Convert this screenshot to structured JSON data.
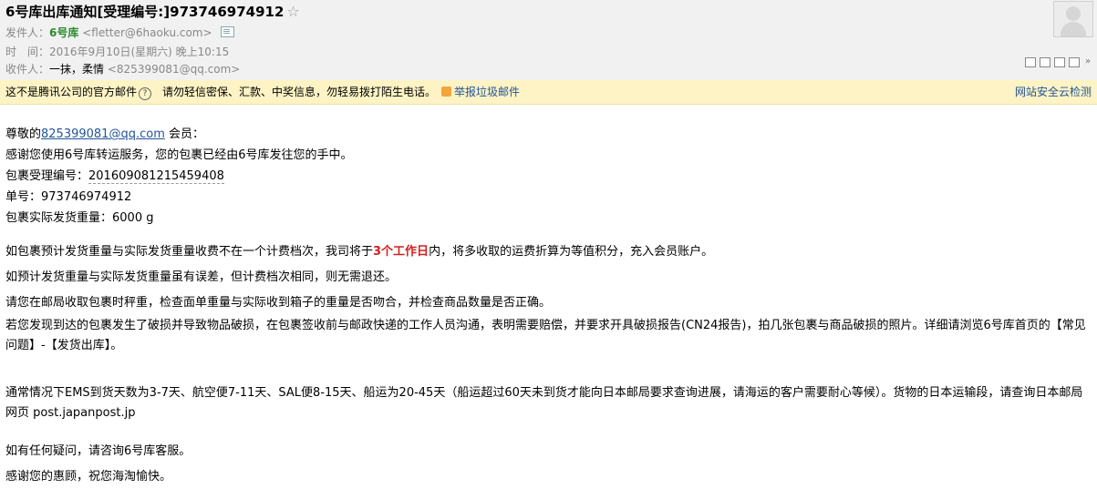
{
  "header": {
    "subject": "6号库出库通知[受理编号:]973746974912",
    "star_glyph": "☆",
    "from_label": "发件人：",
    "from_name": "6号库",
    "from_addr": "<fletter@6haoku.com>",
    "time_label": "时　间：",
    "time_value": "2016年9月10日(星期六) 晚上10:15",
    "to_label": "收件人：",
    "to_names": "一抹，柔情",
    "to_addr": "<825399081@qq.com>"
  },
  "warning": {
    "left_text": "这不是腾讯公司的官方邮件",
    "help_glyph": "?",
    "tip_text": "请勿轻信密保、汇款、中奖信息，勿轻易拨打陌生电话。",
    "report_label": "举报垃圾邮件",
    "security_label": "网站安全云检测"
  },
  "body": {
    "greeting_prefix": "尊敬的",
    "greeting_email": "825399081@qq.com",
    "greeting_suffix": " 会员：",
    "thanks": "感谢您使用6号库转运服务，您的包裹已经由6号库发往您的手中。",
    "package_id_label": "包裹受理编号：",
    "package_id_value": "201609081215459408",
    "tracking_label": "单号：",
    "tracking_value": "973746974912",
    "weight_label": "包裹实际发货重量：",
    "weight_value": "6000 g",
    "para1_a": "如包裹预计发货重量与实际发货重量收费不在一个计费档次，我司将于",
    "para1_highlight": "3个工作日",
    "para1_b": "内，将多收取的运费折算为等值积分，充入会员账户。",
    "para2": "如预计发货重量与实际发货重量虽有误差，但计费档次相同，则无需退还。",
    "para3": "请您在邮局收取包裹时秤重，检查面单重量与实际收到箱子的重量是否吻合，并检查商品数量是否正确。",
    "para4": "若您发现到达的包裹发生了破损并导致物品破损，在包裹签收前与邮政快递的工作人员沟通，表明需要赔偿，并要求开具破损报告(CN24报告)，拍几张包裹与商品破损的照片。详细请浏览6号库首页的【常见问题】-【发货出库】。",
    "para5": "通常情况下EMS到货天数为3-7天、航空便7-11天、SAL便8-15天、船运为20-45天（船运超过60天未到货才能向日本邮局要求查询进展，请海运的客户需要耐心等候）。货物的日本运输段，请查询日本邮局网页 post.japanpost.jp",
    "para6": "如有任何疑问，请咨询6号库客服。",
    "para7": "感谢您的惠顾，祝您海淘愉快。"
  },
  "toolbar": {
    "icons": [
      "restore-window-icon",
      "new-window-icon",
      "open-external-icon",
      "print-icon",
      "more-icon"
    ],
    "chevron_glyph": "»"
  }
}
